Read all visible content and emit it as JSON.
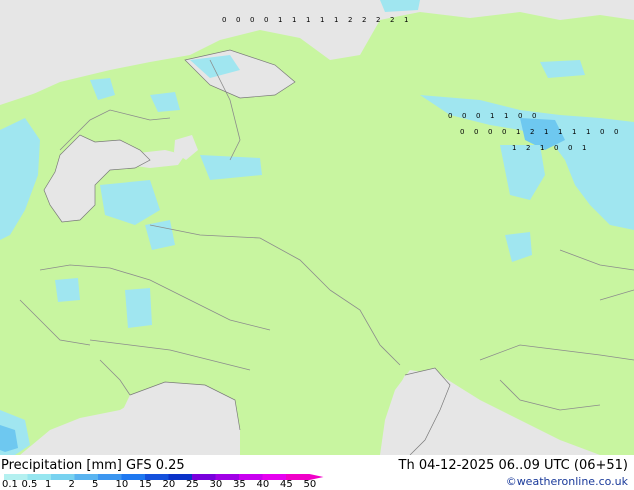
{
  "title": "Precipitation [mm]  GFS 0.25",
  "valid_time": "Th 04-12-2025 06..09 UTC (06+51)",
  "credit": "©weatheronline.co.uk",
  "legend_ticks": [
    "0.1",
    "0.5",
    "1",
    "2",
    "5",
    "10",
    "15",
    "20",
    "25",
    "30",
    "35",
    "40",
    "45",
    "50"
  ],
  "legend_colors": [
    "#b4f0f0",
    "#96e6f0",
    "#78d2f0",
    "#5ab4f0",
    "#3c96f0",
    "#1e78f0",
    "#1450dc",
    "#0a32c8",
    "#7800dc",
    "#a000e6",
    "#c800f0",
    "#e600f0",
    "#f000c8"
  ],
  "map_colors": {
    "land": "#c8f5a0",
    "sea": "#e6e6e6",
    "border": "#8c8c8c",
    "coast": "#7a7a7a",
    "precip_light": "#a0e6f0",
    "precip_med": "#6ec8f0",
    "precip_heavy": "#3c96f0",
    "precip_strong": "#1464dc"
  },
  "station_labels": {
    "row_a": [
      "0",
      "0",
      "0",
      "0",
      "1",
      "1",
      "1",
      "1",
      "1",
      "2",
      "2",
      "2",
      "2",
      "1"
    ],
    "row_b": [
      "0",
      "0",
      "0",
      "1",
      "1",
      "0",
      "0"
    ],
    "row_c": [
      "0",
      "0",
      "0",
      "0",
      "1",
      "2",
      "1",
      "1",
      "1",
      "1",
      "0",
      "0"
    ],
    "row_d": [
      "1",
      "2",
      "1",
      "0",
      "0",
      "1"
    ]
  }
}
